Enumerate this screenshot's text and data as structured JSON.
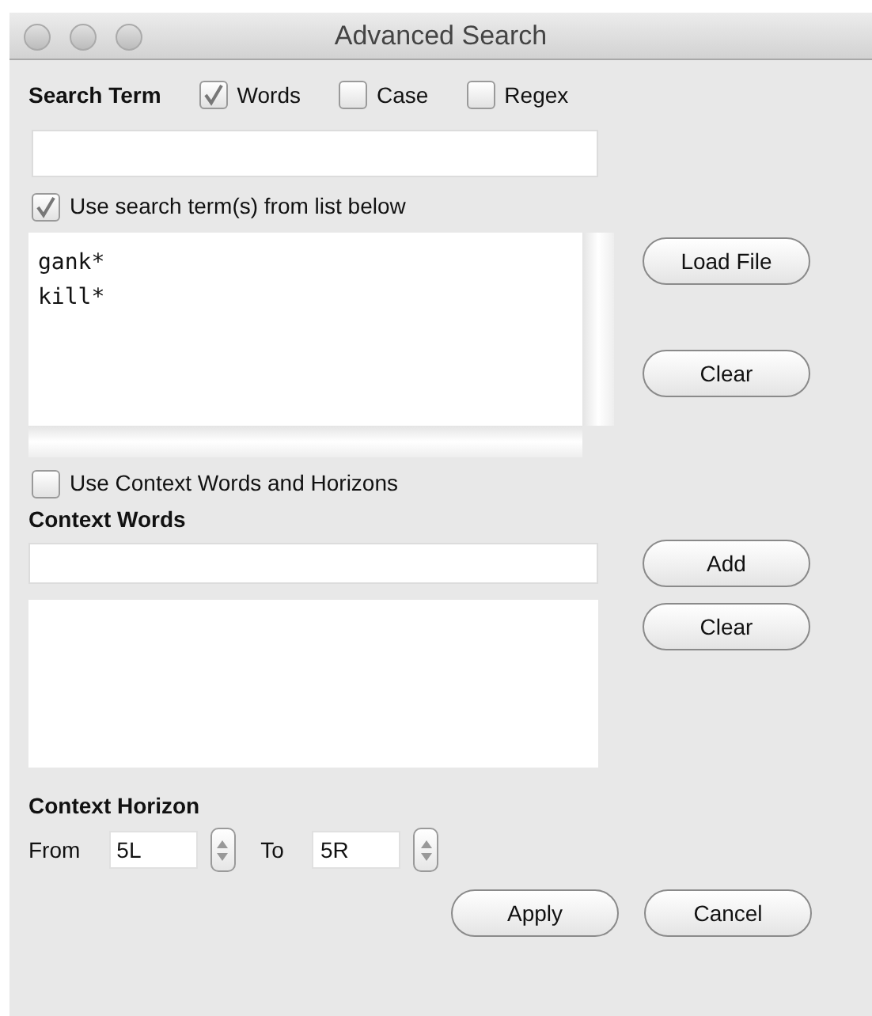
{
  "window": {
    "title": "Advanced Search"
  },
  "search_term": {
    "label": "Search Term",
    "options": [
      {
        "label": "Words",
        "checked": true
      },
      {
        "label": "Case",
        "checked": false
      },
      {
        "label": "Regex",
        "checked": false
      }
    ]
  },
  "use_list": {
    "label": "Use search term(s) from list below",
    "checked": true
  },
  "term_list": {
    "lines": [
      "gank*",
      "kill*"
    ],
    "buttons": [
      "Load File",
      "Clear"
    ]
  },
  "use_context": {
    "label": "Use Context Words and Horizons",
    "checked": false
  },
  "context_words": {
    "label": "Context Words",
    "buttons": [
      "Add",
      "Clear"
    ]
  },
  "context_horizon": {
    "label": "Context Horizon",
    "from_label": "From",
    "from_value": "5L",
    "to_label": "To",
    "to_value": "5R"
  },
  "buttons": [
    "Apply",
    "Cancel"
  ]
}
